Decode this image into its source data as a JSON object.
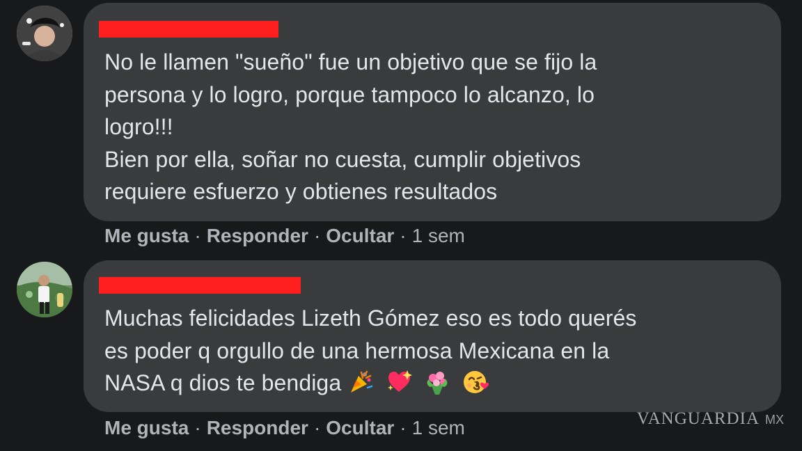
{
  "comments": [
    {
      "avatar": "user-avatar-photo",
      "author_redacted": true,
      "lines": [
        "No le llamen \"sueño\" fue un objetivo que se fijo la",
        "persona y lo logro, porque tampoco lo alcanzo, lo",
        "logro!!!",
        "Bien por ella, soñar no cuesta, cumplir objetivos",
        "requiere esfuerzo y obtienes resultados"
      ],
      "actions": {
        "like": "Me gusta",
        "reply": "Responder",
        "hide": "Ocultar",
        "separator": "·",
        "time": "1 sem"
      }
    },
    {
      "avatar": "user-avatar-photo",
      "author_redacted": true,
      "lines": [
        "Muchas felicidades Lizeth Gómez eso es todo querés",
        "es poder q orgullo de una hermosa Mexicana en la",
        "NASA q dios te bendiga"
      ],
      "emojis": [
        "party-popper-icon",
        "sparkling-heart-icon",
        "bouquet-icon",
        "face-blowing-kiss-icon"
      ],
      "actions": {
        "like": "Me gusta",
        "reply": "Responder",
        "hide": "Ocultar",
        "separator": "·",
        "time": "1 sem"
      }
    }
  ],
  "watermark": {
    "brand": "VANGUARDIA",
    "suffix": "MX"
  },
  "colors": {
    "background": "#18191a",
    "bubble": "#3a3b3c",
    "text": "#e4e6eb",
    "meta_text": "#b0b3b8",
    "redaction": "#ff1f1f"
  }
}
